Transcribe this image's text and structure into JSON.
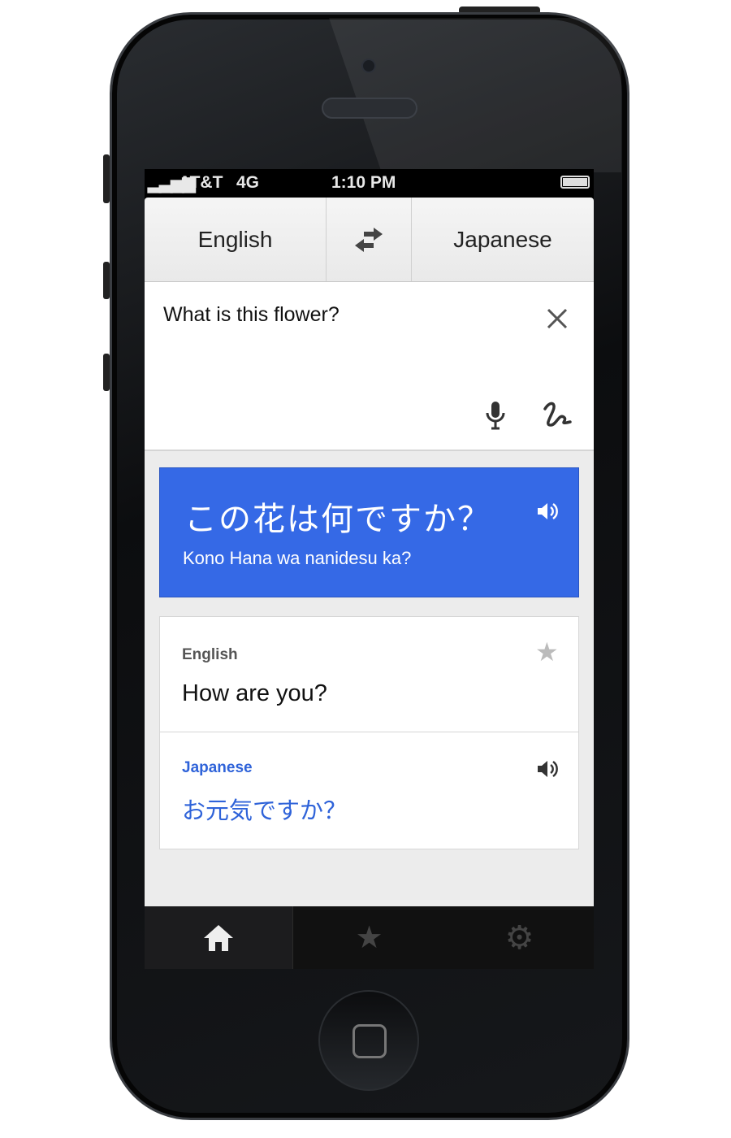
{
  "status": {
    "carrier": "AT&T",
    "network": "4G",
    "time": "1:10 PM"
  },
  "languages": {
    "source": "English",
    "target": "Japanese",
    "swap_icon": "swap-arrows-icon"
  },
  "input": {
    "text": "What is this flower?",
    "icons": [
      "close-icon",
      "microphone-icon",
      "handwriting-icon"
    ]
  },
  "result": {
    "translation": "この花は何ですか？",
    "romanization": "Kono Hana wa nanidesu ka?",
    "icon": "speaker-icon"
  },
  "history": {
    "source_lang": "English",
    "source_text": "How are you?",
    "target_lang": "Japanese",
    "target_text": "お元気ですか？"
  },
  "tabs": [
    {
      "name": "home",
      "active": true
    },
    {
      "name": "starred"
    },
    {
      "name": "settings"
    }
  ],
  "colors": {
    "accent": "#3569e6",
    "link": "#2f63d9"
  }
}
